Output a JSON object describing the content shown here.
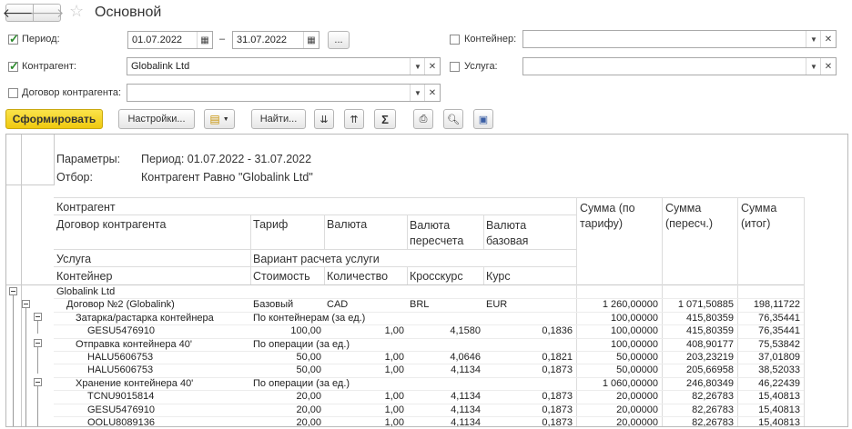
{
  "window": {
    "title": "Основной"
  },
  "filters": {
    "period": {
      "label": "Период:",
      "checked": true,
      "from": "01.07.2022",
      "dash": "–",
      "to": "31.07.2022",
      "more": "..."
    },
    "counterparty": {
      "label": "Контрагент:",
      "checked": true,
      "value": "Globalink Ltd"
    },
    "contract": {
      "label": "Договор контрагента:",
      "checked": false,
      "value": ""
    },
    "container": {
      "label": "Контейнер:",
      "checked": false,
      "value": ""
    },
    "service": {
      "label": "Услуга:",
      "checked": false,
      "value": ""
    }
  },
  "toolbar": {
    "generate": "Сформировать",
    "settings": "Настройки...",
    "find": "Найти...",
    "sum": "Σ"
  },
  "report": {
    "params_label": "Параметры:",
    "params_value": "Период: 01.07.2022 - 31.07.2022",
    "filter_label": "Отбор:",
    "filter_value": "Контрагент Равно \"Globalink Ltd\"",
    "headers": {
      "counterparty": "Контрагент",
      "contract": "Договор контрагента",
      "tariff": "Тариф",
      "currency": "Валюта",
      "currency_recalc": "Валюта пересчета",
      "currency_base": "Валюта базовая",
      "service": "Услуга",
      "calc_variant": "Вариант расчета услуги",
      "container": "Контейнер",
      "cost": "Стоимость",
      "qty": "Количество",
      "cross_rate": "Кросскурс",
      "rate": "Курс",
      "sum_tariff": "Сумма (по тарифу)",
      "sum_recalc": "Сумма (пересч.)",
      "sum_total": "Сумма (итог)"
    },
    "rows": [
      {
        "level": 0,
        "c1": "Globalink Ltd",
        "c2": "",
        "c3": "",
        "c4": "",
        "c5": "",
        "s1": "",
        "s2": "",
        "s3": ""
      },
      {
        "level": 1,
        "c1": "Договор №2 (Globalink)",
        "c2": "Базовый",
        "c3": "CAD",
        "c4": "BRL",
        "c5": "EUR",
        "s1": "1 260,00000",
        "s2": "1 071,50885",
        "s3": "198,11722"
      },
      {
        "level": 2,
        "c1": "Затарка/растарка контейнера",
        "c2": "По контейнерам (за ед.)",
        "c3": "",
        "c4": "",
        "c5": "",
        "s1": "100,00000",
        "s2": "415,80359",
        "s3": "76,35441"
      },
      {
        "level": 3,
        "c1": "GESU5476910",
        "c2": "100,00",
        "c3": "1,00",
        "c4": "4,1580",
        "c5": "0,1836",
        "s1": "100,00000",
        "s2": "415,80359",
        "s3": "76,35441"
      },
      {
        "level": 2,
        "c1": "Отправка контейнера 40'",
        "c2": "По операции (за ед.)",
        "c3": "",
        "c4": "",
        "c5": "",
        "s1": "100,00000",
        "s2": "408,90177",
        "s3": "75,53842"
      },
      {
        "level": 3,
        "c1": "HALU5606753",
        "c2": "50,00",
        "c3": "1,00",
        "c4": "4,0646",
        "c5": "0,1821",
        "s1": "50,00000",
        "s2": "203,23219",
        "s3": "37,01809"
      },
      {
        "level": 3,
        "c1": "HALU5606753",
        "c2": "50,00",
        "c3": "1,00",
        "c4": "4,1134",
        "c5": "0,1873",
        "s1": "50,00000",
        "s2": "205,66958",
        "s3": "38,52033"
      },
      {
        "level": 2,
        "c1": "Хранение контейнера 40'",
        "c2": "По операции (за ед.)",
        "c3": "",
        "c4": "",
        "c5": "",
        "s1": "1 060,00000",
        "s2": "246,80349",
        "s3": "46,22439"
      },
      {
        "level": 3,
        "c1": "TCNU9015814",
        "c2": "20,00",
        "c3": "1,00",
        "c4": "4,1134",
        "c5": "0,1873",
        "s1": "20,00000",
        "s2": "82,26783",
        "s3": "15,40813"
      },
      {
        "level": 3,
        "c1": "GESU5476910",
        "c2": "20,00",
        "c3": "1,00",
        "c4": "4,1134",
        "c5": "0,1873",
        "s1": "20,00000",
        "s2": "82,26783",
        "s3": "15,40813"
      },
      {
        "level": 3,
        "c1": "OOLU8089136",
        "c2": "20,00",
        "c3": "1,00",
        "c4": "4,1134",
        "c5": "0,1873",
        "s1": "20,00000",
        "s2": "82,26783",
        "s3": "15,40813"
      }
    ]
  },
  "colors": {
    "accent": "#f4d31f",
    "check": "#2e8b2e",
    "border": "#b9b9b9"
  }
}
